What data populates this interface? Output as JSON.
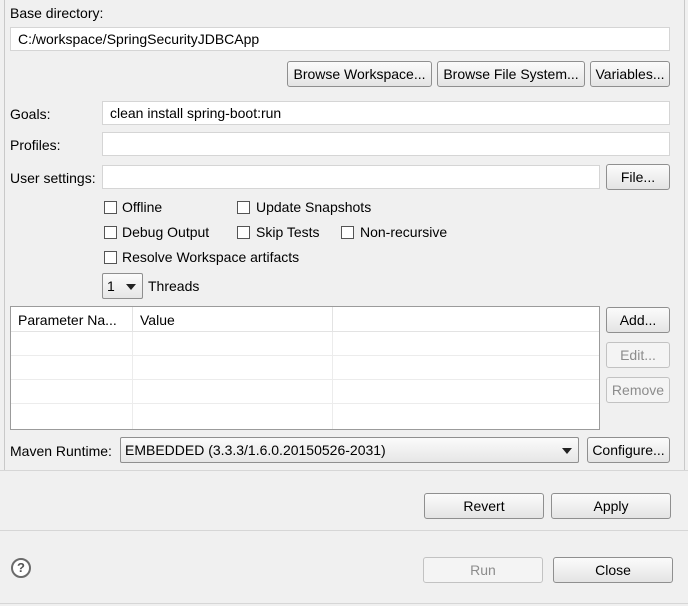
{
  "base_directory": {
    "label": "Base directory:",
    "value": "C:/workspace/SpringSecurityJDBCApp",
    "buttons": {
      "browse_workspace": "Browse Workspace...",
      "browse_file_system": "Browse File System...",
      "variables": "Variables..."
    }
  },
  "goals": {
    "label": "Goals:",
    "value": "clean install spring-boot:run"
  },
  "profiles": {
    "label": "Profiles:",
    "value": ""
  },
  "user_settings": {
    "label": "User settings:",
    "value": "",
    "file_button": "File..."
  },
  "options": {
    "offline": {
      "label": "Offline",
      "checked": false
    },
    "update_snapshots": {
      "label": "Update Snapshots",
      "checked": false
    },
    "debug_output": {
      "label": "Debug Output",
      "checked": false
    },
    "skip_tests": {
      "label": "Skip Tests",
      "checked": false
    },
    "non_recursive": {
      "label": "Non-recursive",
      "checked": false
    },
    "resolve_workspace": {
      "label": "Resolve Workspace artifacts",
      "checked": false
    }
  },
  "threads": {
    "value": "1",
    "label": "Threads"
  },
  "parameters": {
    "columns": [
      "Parameter Na...",
      "Value"
    ],
    "rows": [],
    "buttons": {
      "add": "Add...",
      "edit": "Edit...",
      "remove": "Remove"
    }
  },
  "maven_runtime": {
    "label": "Maven Runtime:",
    "value": "EMBEDDED (3.3.3/1.6.0.20150526-2031)",
    "configure_button": "Configure..."
  },
  "footer": {
    "revert": "Revert",
    "apply": "Apply",
    "run": "Run",
    "close": "Close",
    "help_symbol": "?"
  }
}
